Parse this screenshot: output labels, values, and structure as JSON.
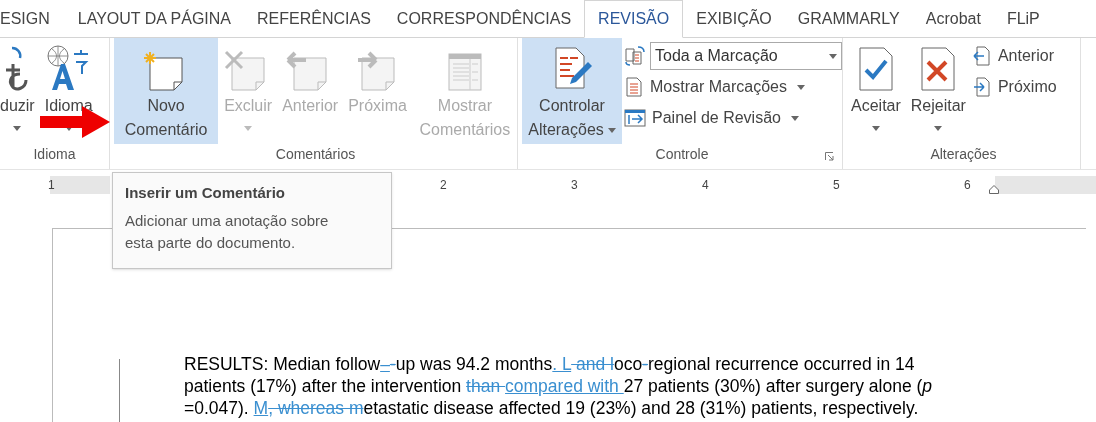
{
  "tabs": [
    {
      "label": "ESIGN",
      "selected": false
    },
    {
      "label": "LAYOUT DA PÁGINA",
      "selected": false
    },
    {
      "label": "REFERÊNCIAS",
      "selected": false
    },
    {
      "label": "CORRESPONDÊNCIAS",
      "selected": false
    },
    {
      "label": "REVISÃO",
      "selected": true
    },
    {
      "label": "EXIBIÇÃO",
      "selected": false
    },
    {
      "label": "GRAMMARLY",
      "selected": false
    },
    {
      "label": "Acrobat",
      "selected": false
    },
    {
      "label": "FLiP",
      "selected": false
    }
  ],
  "ribbon": {
    "groups": [
      {
        "label": "Idioma",
        "launcher": false,
        "items": [
          {
            "kind": "large",
            "label": "duzir",
            "selected": false,
            "disabled": false,
            "dropdown": true
          },
          {
            "kind": "large",
            "label": "Idioma",
            "selected": false,
            "disabled": false,
            "dropdown": true
          }
        ]
      },
      {
        "label": "Comentários",
        "launcher": false,
        "items": [
          {
            "kind": "large",
            "label": "Novo Comentário",
            "selected": true,
            "disabled": false,
            "dropdown": false
          },
          {
            "kind": "large",
            "label": "Excluir",
            "selected": false,
            "disabled": true,
            "dropdown": true
          },
          {
            "kind": "large",
            "label": "Anterior",
            "selected": false,
            "disabled": true,
            "dropdown": false
          },
          {
            "kind": "large",
            "label": "Próxima",
            "selected": false,
            "disabled": true,
            "dropdown": false
          },
          {
            "kind": "large",
            "label": "Mostrar Comentários",
            "selected": false,
            "disabled": true,
            "dropdown": false
          }
        ]
      },
      {
        "label": "Controle",
        "launcher": true,
        "items": [
          {
            "kind": "large",
            "label": "Controlar Alterações",
            "selected": true,
            "disabled": false,
            "dropdown": true
          },
          {
            "kind": "stack",
            "rows": [
              {
                "kind": "combo",
                "value": "Toda a Marcação"
              },
              {
                "kind": "small",
                "label": "Mostrar Marcações",
                "dropdown": true
              },
              {
                "kind": "small",
                "label": "Painel de Revisão",
                "dropdown": true
              }
            ]
          }
        ]
      },
      {
        "label": "Alterações",
        "launcher": false,
        "items": [
          {
            "kind": "large",
            "label": "Aceitar",
            "selected": false,
            "disabled": false,
            "dropdown": true
          },
          {
            "kind": "large",
            "label": "Rejeitar",
            "selected": false,
            "disabled": false,
            "dropdown": true
          },
          {
            "kind": "stack",
            "rows": [
              {
                "kind": "small",
                "label": "Anterior",
                "dropdown": false
              },
              {
                "kind": "small",
                "label": "Próximo",
                "dropdown": false
              }
            ]
          }
        ]
      }
    ]
  },
  "ruler": {
    "labels": [
      "1",
      "2",
      "3",
      "4",
      "5",
      "6"
    ]
  },
  "tooltip": {
    "title": "Inserir um Comentário",
    "text": "Adicionar uma anotação sobre esta parte do documento."
  },
  "document": {
    "lines": [
      [
        {
          "kind": "normal",
          "text": "RESULTS: Median follow"
        },
        {
          "kind": "insert",
          "text": "–"
        },
        {
          "kind": "delete",
          "text": "-"
        },
        {
          "kind": "normal",
          "text": "up was 94.2 months"
        },
        {
          "kind": "insert",
          "text": ". L"
        },
        {
          "kind": "delete",
          "text": " and l"
        },
        {
          "kind": "normal",
          "text": "oco"
        },
        {
          "kind": "delete",
          "text": "-"
        },
        {
          "kind": "normal",
          "text": "regional recurrence occurred in 14"
        }
      ],
      [
        {
          "kind": "normal",
          "text": "patients (17%) after the intervention "
        },
        {
          "kind": "delete",
          "text": "than "
        },
        {
          "kind": "insert",
          "text": "compared with "
        },
        {
          "kind": "normal",
          "text": "27 patients (30%) after surgery alone (*p*"
        }
      ],
      [
        {
          "kind": "normal",
          "text": "=0.047). "
        },
        {
          "kind": "insert",
          "text": "M"
        },
        {
          "kind": "delete",
          "text": ", whereas m"
        },
        {
          "kind": "normal",
          "text": "etastatic disease affected 19 (23%) and 28 (31%) patients, respectively."
        }
      ]
    ]
  }
}
